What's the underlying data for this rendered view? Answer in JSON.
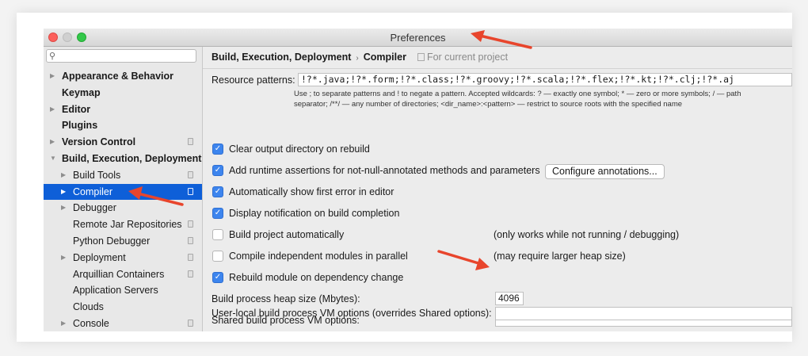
{
  "window": {
    "title": "Preferences"
  },
  "sidebar": {
    "search_placeholder": "",
    "items": [
      {
        "label": "Appearance & Behavior",
        "bold": true,
        "arrow": "▶"
      },
      {
        "label": "Keymap",
        "bold": true
      },
      {
        "label": "Editor",
        "bold": true,
        "arrow": "▶"
      },
      {
        "label": "Plugins",
        "bold": true
      },
      {
        "label": "Version Control",
        "bold": true,
        "arrow": "▶",
        "project": true
      },
      {
        "label": "Build, Execution, Deployment",
        "bold": true,
        "arrow": "▼"
      },
      {
        "label": "Build Tools",
        "arrow": "▶",
        "project": true
      },
      {
        "label": "Compiler",
        "arrow": "▶",
        "project": true,
        "selected": true
      },
      {
        "label": "Debugger",
        "arrow": "▶"
      },
      {
        "label": "Remote Jar Repositories",
        "project": true
      },
      {
        "label": "Python Debugger",
        "project": true
      },
      {
        "label": "Deployment",
        "arrow": "▶",
        "project": true
      },
      {
        "label": "Arquillian Containers",
        "project": true
      },
      {
        "label": "Application Servers"
      },
      {
        "label": "Clouds"
      },
      {
        "label": "Console",
        "arrow": "▶",
        "project": true
      }
    ]
  },
  "breadcrumb": {
    "parent": "Build, Execution, Deployment",
    "separator": "›",
    "current": "Compiler",
    "scope": "For current project"
  },
  "resource_patterns": {
    "label": "Resource patterns:",
    "value": "!?*.java;!?*.form;!?*.class;!?*.groovy;!?*.scala;!?*.flex;!?*.kt;!?*.clj;!?*.aj",
    "hint_line1": "Use ; to separate patterns and ! to negate a pattern. Accepted wildcards: ? — exactly one symbol; * — zero or more symbols; / — path",
    "hint_line2": "separator; /**/ — any number of directories; <dir_name>:<pattern> — restrict to source roots with the specified name"
  },
  "options": {
    "clear_output": {
      "label": "Clear output directory on rebuild",
      "checked": true
    },
    "runtime_assertions": {
      "label": "Add runtime assertions for not-null-annotated methods and parameters",
      "checked": true
    },
    "configure_button": "Configure annotations...",
    "show_first_error": {
      "label": "Automatically show first error in editor",
      "checked": true
    },
    "display_notification": {
      "label": "Display notification on build completion",
      "checked": true
    },
    "build_automatically": {
      "label": "Build project automatically",
      "checked": false,
      "note": "(only works while not running / debugging)"
    },
    "compile_parallel": {
      "label": "Compile independent modules in parallel",
      "checked": false,
      "note": "(may require larger heap size)"
    },
    "rebuild_on_dependency": {
      "label": "Rebuild module on dependency change",
      "checked": true
    }
  },
  "heap": {
    "label": "Build process heap size (Mbytes):",
    "value": "4096"
  },
  "shared_vm": {
    "label": "Shared build process VM options:",
    "value": ""
  },
  "user_vm": {
    "label": "User-local build process VM options (overrides Shared options):",
    "value": ""
  },
  "colors": {
    "selection": "#0e5fd8",
    "checkbox": "#3d85ee",
    "arrow": "#e8452c"
  }
}
